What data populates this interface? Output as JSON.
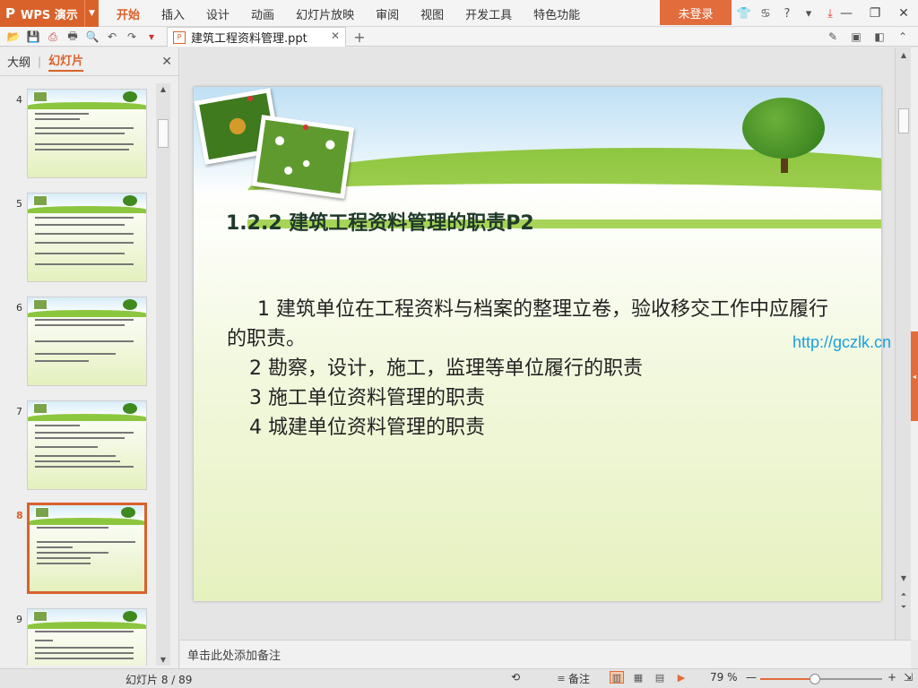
{
  "app": {
    "name": "WPS 演示",
    "logo": "P"
  },
  "menu": [
    "开始",
    "插入",
    "设计",
    "动画",
    "幻灯片放映",
    "审阅",
    "视图",
    "开发工具",
    "特色功能"
  ],
  "menu_active": 0,
  "login_label": "未登录",
  "title_icons": [
    "shirt-icon",
    "skin-icon",
    "help-icon",
    "dropdown-icon",
    "download-icon"
  ],
  "window_controls": [
    "minimize-icon",
    "restore-icon",
    "close-icon"
  ],
  "quick_access": [
    "open-icon",
    "save-icon",
    "export-pdf-icon",
    "print-icon",
    "print-preview-icon",
    "undo-icon",
    "redo-icon",
    "customize-icon"
  ],
  "doc_tab": {
    "title": "建筑工程资料管理.ppt",
    "icon": "ppt-file-icon"
  },
  "toolbar_right": [
    "brush-icon",
    "comment-icon",
    "compare-icon",
    "collapse-ribbon-icon"
  ],
  "left_panel": {
    "tabs": [
      "大纲",
      "幻灯片"
    ],
    "active_tab": 1,
    "thumbnails": [
      {
        "number": "4",
        "active": false
      },
      {
        "number": "5",
        "active": false
      },
      {
        "number": "6",
        "active": false
      },
      {
        "number": "7",
        "active": false
      },
      {
        "number": "8",
        "active": true
      },
      {
        "number": "9",
        "active": false
      }
    ]
  },
  "slide": {
    "title": "1.2.2 建筑工程资料管理的职责P2",
    "body": [
      "1 建筑单位在工程资料与档案的整理立卷，验收移交工作中应履行的职责。",
      "2 勘察，设计，施工，监理等单位履行的职责",
      "3 施工单位资料管理的职责",
      "4 城建单位资料管理的职责"
    ]
  },
  "watermark_url": "http://gczlk.cn",
  "notes_placeholder": "单击此处添加备注",
  "status": {
    "slide_counter": "幻灯片 8 / 89",
    "notes_label": "备注",
    "zoom": "79 %",
    "zoom_fraction": 0.45
  }
}
